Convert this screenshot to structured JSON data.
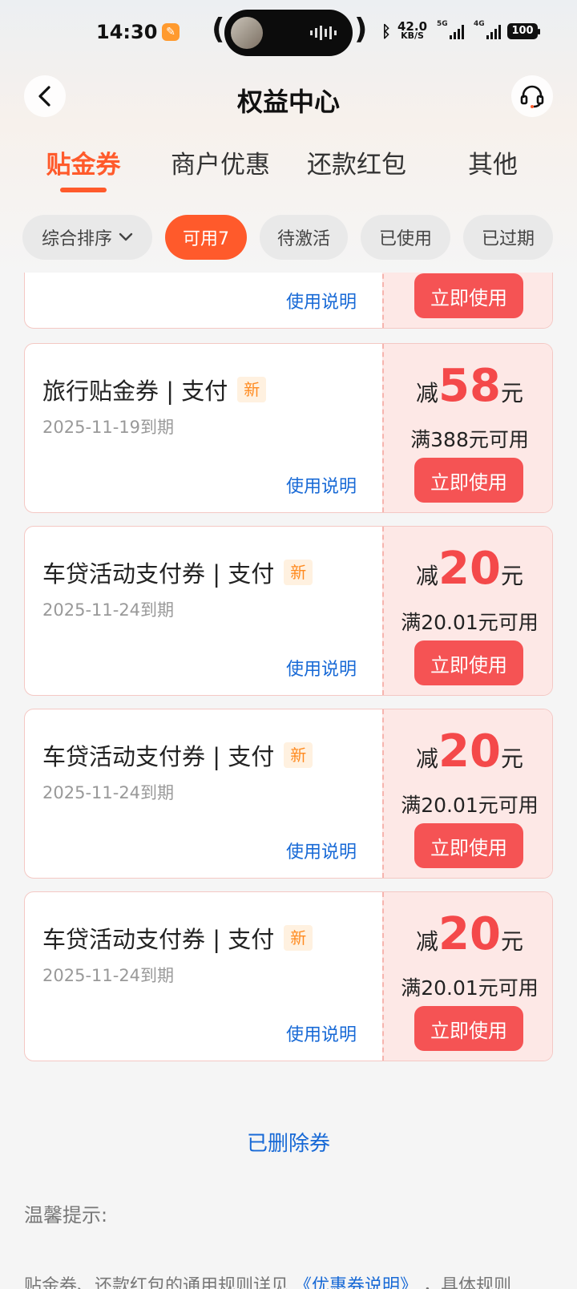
{
  "status_bar": {
    "time": "14:30",
    "network_speed_value": "42.0",
    "network_speed_unit": "KB/S",
    "signal1_label": "5G",
    "signal2_label": "4G",
    "battery": "100"
  },
  "header": {
    "title": "权益中心"
  },
  "tabs": [
    {
      "label": "贴金券",
      "active": true
    },
    {
      "label": "商户优惠"
    },
    {
      "label": "还款红包"
    },
    {
      "label": "其他"
    }
  ],
  "filters": {
    "sort_label": "综合排序",
    "chips": [
      {
        "label": "可用7",
        "active": true
      },
      {
        "label": "待激活"
      },
      {
        "label": "已使用"
      },
      {
        "label": "已过期"
      }
    ]
  },
  "coupons": [
    {
      "title": "",
      "badge": "",
      "expiry": "",
      "instructions": "使用说明",
      "prefix": "",
      "amount": "",
      "unit": "",
      "condition": "",
      "button": "立即使用"
    },
    {
      "title": "旅行贴金券 | 支付",
      "badge": "新",
      "expiry": "2025-11-19到期",
      "instructions": "使用说明",
      "prefix": "减",
      "amount": "58",
      "unit": "元",
      "condition": "满388元可用",
      "button": "立即使用"
    },
    {
      "title": "车贷活动支付券 | 支付",
      "badge": "新",
      "expiry": "2025-11-24到期",
      "instructions": "使用说明",
      "prefix": "减",
      "amount": "20",
      "unit": "元",
      "condition": "满20.01元可用",
      "button": "立即使用"
    },
    {
      "title": "车贷活动支付券 | 支付",
      "badge": "新",
      "expiry": "2025-11-24到期",
      "instructions": "使用说明",
      "prefix": "减",
      "amount": "20",
      "unit": "元",
      "condition": "满20.01元可用",
      "button": "立即使用"
    },
    {
      "title": "车贷活动支付券 | 支付",
      "badge": "新",
      "expiry": "2025-11-24到期",
      "instructions": "使用说明",
      "prefix": "减",
      "amount": "20",
      "unit": "元",
      "condition": "满20.01元可用",
      "button": "立即使用"
    }
  ],
  "footer": {
    "deleted_link": "已删除券",
    "tips_title": "温馨提示:",
    "tips_text_before": "贴金券、还款红包的通用规则详见",
    "tips_link": "《优惠券说明》",
    "tips_text_after": "，具体规则"
  },
  "colors": {
    "accent": "#ff5a2b",
    "coupon_amount": "#f4494a",
    "use_button": "#f55354",
    "link": "#1769d6"
  }
}
